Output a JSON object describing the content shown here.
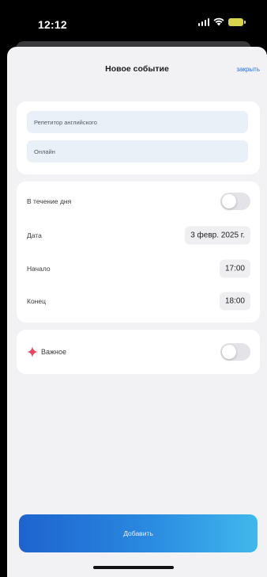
{
  "status_bar": {
    "time": "12:12"
  },
  "sheet": {
    "title": "Новое событие",
    "close_label": "закрыть"
  },
  "fields": {
    "title_value": "Репетитор английского",
    "location_value": "Онлайн"
  },
  "schedule": {
    "all_day_label": "В течение дня",
    "all_day_enabled": false,
    "date_label": "Дата",
    "date_value": "3 февр. 2025 г.",
    "start_label": "Начало",
    "start_value": "17:00",
    "end_label": "Конец",
    "end_value": "18:00"
  },
  "important": {
    "label": "Важное",
    "enabled": false,
    "icon": "sparkle-icon",
    "icon_color": "#e8475f"
  },
  "actions": {
    "add_label": "Добавить"
  },
  "colors": {
    "accent": "#2f6fd6",
    "button_gradient_start": "#1e63cf",
    "button_gradient_end": "#41b8ec"
  }
}
